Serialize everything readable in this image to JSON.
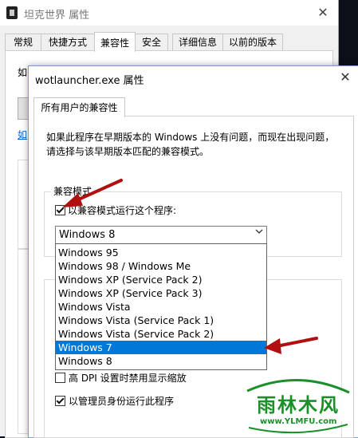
{
  "back_window": {
    "title": "坦克世界 属性",
    "close": "✕",
    "tabs": [
      {
        "label": "常规"
      },
      {
        "label": "快捷方式"
      },
      {
        "label": "兼容性"
      },
      {
        "label": "安全"
      },
      {
        "label": "详细信息"
      },
      {
        "label": "以前的版本"
      }
    ],
    "frag_text1": "如",
    "frag_link": "如"
  },
  "dialog": {
    "title": "wotlauncher.exe 属性",
    "close": "✕",
    "tab": "所有用户的兼容性",
    "description": "如果此程序在早期版本的 Windows 上没有问题，而现在出现问题，请选择与该早期版本匹配的兼容模式。",
    "compat_group_label": "兼容模式",
    "compat_checkbox_label": "以兼容模式运行这个程序:",
    "compat_checked": true,
    "dropdown_value": "Windows 8",
    "dropdown_options": [
      "Windows 95",
      "Windows 98 / Windows Me",
      "Windows XP (Service Pack 2)",
      "Windows XP (Service Pack 3)",
      "Windows Vista",
      "Windows Vista (Service Pack 1)",
      "Windows Vista (Service Pack 2)",
      "Windows 7",
      "Windows 8"
    ],
    "highlighted_option": "Windows 7",
    "dpi_label": "高 DPI 设置时禁用显示缩放",
    "dpi_checked": false,
    "admin_label": "以管理员身份运行此程序",
    "admin_checked": true
  },
  "watermark": {
    "text": "雨林木风",
    "url": "www.YLMFU.com"
  },
  "colors": {
    "selection": "#0078d7",
    "arrow": "#b01010",
    "watermark": "#1a8f2a"
  }
}
